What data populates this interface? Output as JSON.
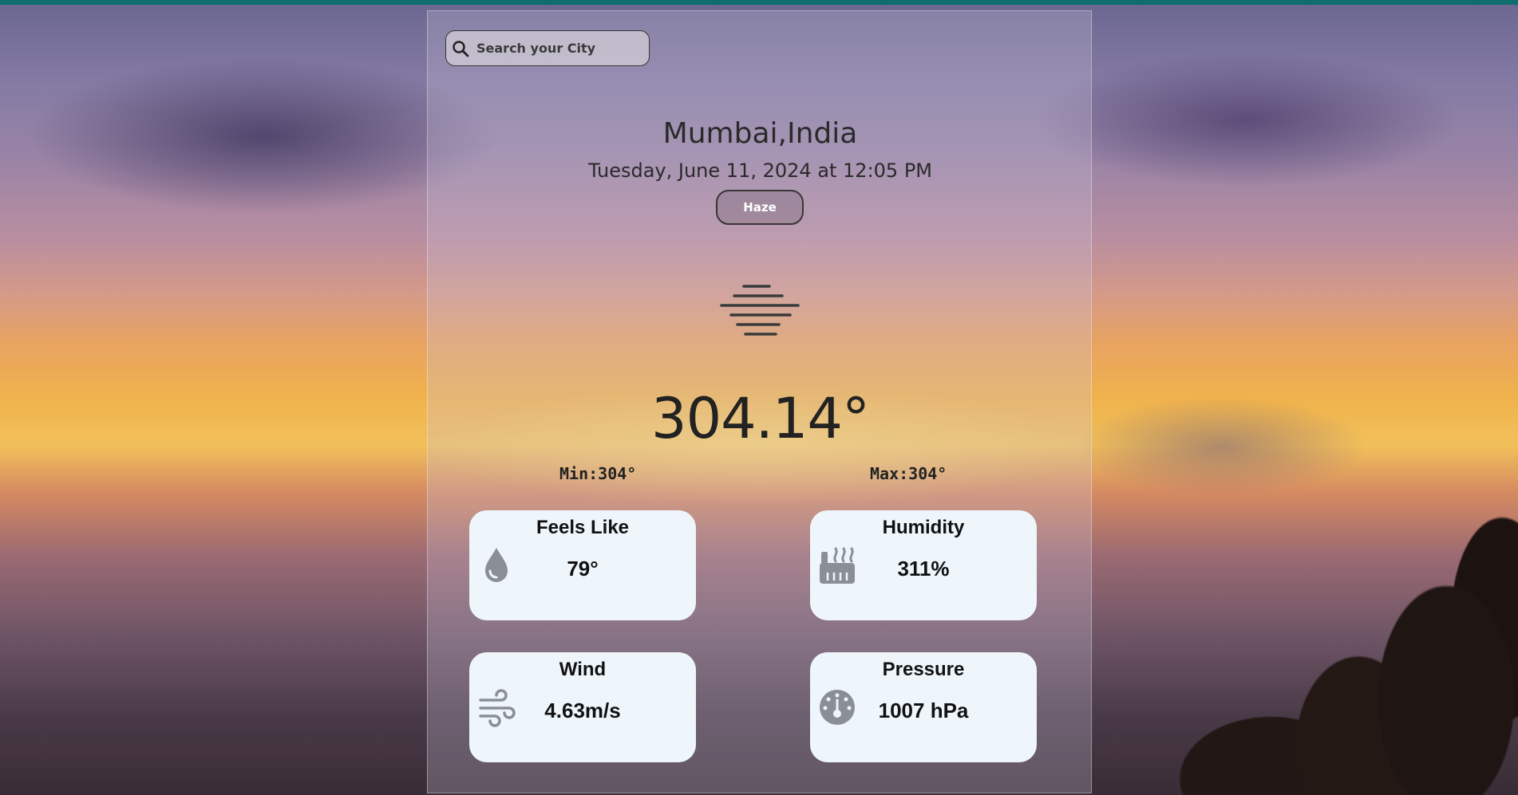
{
  "search": {
    "placeholder": "Search your City"
  },
  "location": "Mumbai,India",
  "datetime": "Tuesday, June 11, 2024 at 12:05 PM",
  "condition": "Haze",
  "temperature": "304.14°",
  "min": "Min:304°",
  "max": "Max:304°",
  "tiles": {
    "feels_like": {
      "title": "Feels Like",
      "value": "79°",
      "icon": "droplet-icon"
    },
    "humidity": {
      "title": "Humidity",
      "value": "311%",
      "icon": "humidity-factory-icon"
    },
    "wind": {
      "title": "Wind",
      "value": "4.63m/s",
      "icon": "wind-icon"
    },
    "pressure": {
      "title": "Pressure",
      "value": "1007 hPa",
      "icon": "gauge-icon"
    }
  },
  "colors": {
    "top_bar": "#0e6e6e",
    "tile_bg": "#eef6fc",
    "icon_gray": "#8a8f96"
  }
}
